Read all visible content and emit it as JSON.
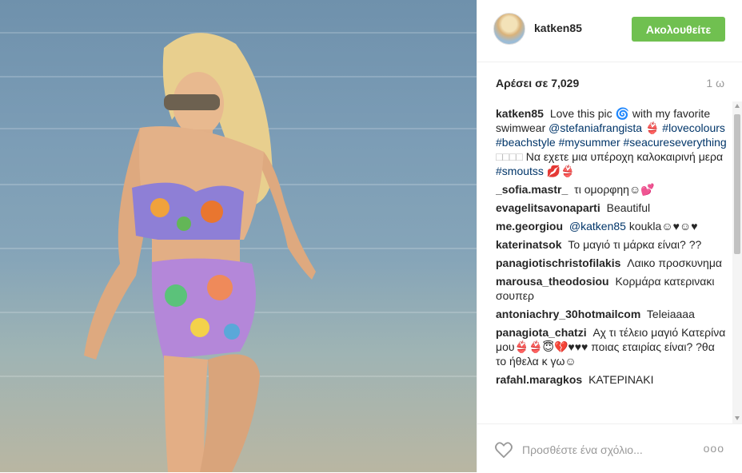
{
  "post": {
    "username": "katken85",
    "follow_label": "Ακολουθείτε",
    "likes_text": "Αρέσει σε 7,029",
    "time_ago": "1 ω"
  },
  "caption": {
    "user": "katken85",
    "text_1": "Love this pic 🌀 with my favorite swimwear",
    "mention": "@stefaniafrangista",
    "emoji_1": "👙",
    "hashtags": "#lovecolours #beachstyle #mysummer #seacureseverything",
    "boxes": "□□□□",
    "text_2": "Να εχετε μια υπέροχη καλοκαιρινή μερα",
    "hashtag_2": "#smoutss",
    "emoji_2": "💋👙"
  },
  "comments": [
    {
      "user": "_sofia.mastr_",
      "text": "τι ομορφηη☺💕"
    },
    {
      "user": "evagelitsavonaparti",
      "text": "Beautiful"
    },
    {
      "user": "me.georgiou",
      "mention": "@katken85",
      "text": "koukla☺♥☺♥"
    },
    {
      "user": "katerinatsok",
      "text": "Το μαγιό τι μάρκα είναι? ??"
    },
    {
      "user": "panagiotischristofilakis",
      "text": "Λαικο προσκυνημα"
    },
    {
      "user": "marousa_theodosiou",
      "text": "Κορμάρα κατερινακι σουπερ"
    },
    {
      "user": "antoniachry_30hotmailcom",
      "text": "Teleiaaaa"
    },
    {
      "user": "panagiota_chatzi",
      "text": "Αχ τι τέλειο μαγιό Κατερίνα μου👙👙😇💔♥♥♥ ποιας εταιρίας είναι? ?θα το ήθελα κ γω☺"
    },
    {
      "user": "rafahl.maragkos",
      "text": "ΚΑΤΕΡΙΝΑΚΙ"
    }
  ],
  "footer": {
    "add_comment_placeholder": "Προσθέστε ένα σχόλιο...",
    "more_label": "ooo"
  },
  "icons": {
    "like": "heart-outline-icon",
    "more": "more-options-icon"
  },
  "colors": {
    "follow_button": "#70c050",
    "link": "#003569"
  }
}
